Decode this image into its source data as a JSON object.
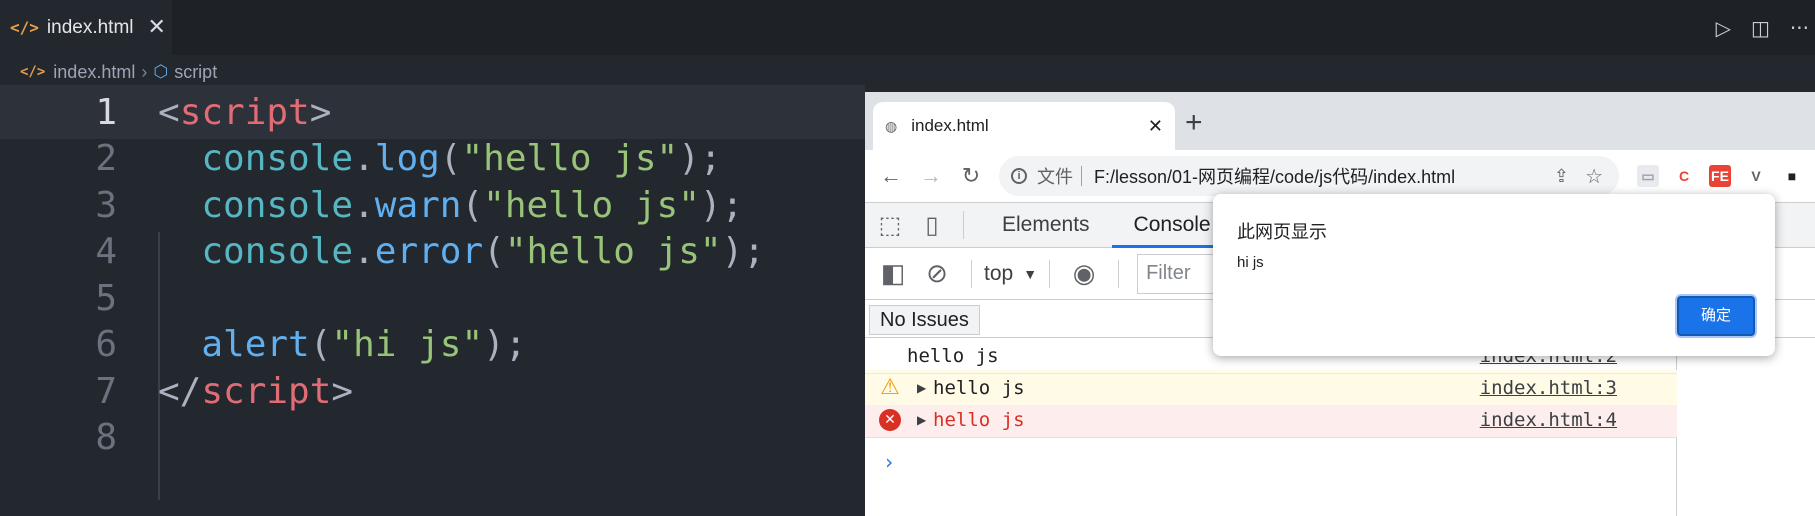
{
  "editor": {
    "tab": {
      "icon": "</>",
      "label": "index.html",
      "close": "✕"
    },
    "actions": {
      "run": "▷",
      "split": "◫",
      "more": "···"
    },
    "breadcrumb": {
      "icon": "</>",
      "file": "index.html",
      "sep": "›",
      "symbol_icon": "⬡",
      "symbol": "script"
    },
    "lines": [
      {
        "n": "1",
        "tokens": [
          [
            "t-punc",
            "<"
          ],
          [
            "t-tag",
            "script"
          ],
          [
            "t-punc",
            ">"
          ]
        ]
      },
      {
        "n": "2",
        "tokens": [
          [
            "t-punc",
            "  "
          ],
          [
            "t-obj",
            "console"
          ],
          [
            "t-punc",
            "."
          ],
          [
            "t-fn",
            "log"
          ],
          [
            "t-punc",
            "("
          ],
          [
            "t-str",
            "\"hello js\""
          ],
          [
            "t-punc",
            ");"
          ]
        ]
      },
      {
        "n": "3",
        "tokens": [
          [
            "t-punc",
            "  "
          ],
          [
            "t-obj",
            "console"
          ],
          [
            "t-punc",
            "."
          ],
          [
            "t-fn",
            "warn"
          ],
          [
            "t-punc",
            "("
          ],
          [
            "t-str",
            "\"hello js\""
          ],
          [
            "t-punc",
            ");"
          ]
        ]
      },
      {
        "n": "4",
        "tokens": [
          [
            "t-punc",
            "  "
          ],
          [
            "t-obj",
            "console"
          ],
          [
            "t-punc",
            "."
          ],
          [
            "t-fn",
            "error"
          ],
          [
            "t-punc",
            "("
          ],
          [
            "t-str",
            "\"hello js\""
          ],
          [
            "t-punc",
            ");"
          ]
        ]
      },
      {
        "n": "5",
        "tokens": []
      },
      {
        "n": "6",
        "tokens": [
          [
            "t-punc",
            "  "
          ],
          [
            "t-fn",
            "alert"
          ],
          [
            "t-punc",
            "("
          ],
          [
            "t-str",
            "\"hi js\""
          ],
          [
            "t-punc",
            ");"
          ]
        ]
      },
      {
        "n": "7",
        "tokens": [
          [
            "t-punc",
            "</"
          ],
          [
            "t-tag",
            "script"
          ],
          [
            "t-punc",
            ">"
          ]
        ]
      },
      {
        "n": "8",
        "tokens": []
      }
    ]
  },
  "browser": {
    "tab": {
      "label": "index.html",
      "close": "✕"
    },
    "new_tab": "+",
    "nav": {
      "back": "←",
      "forward": "→",
      "reload": "↻"
    },
    "omnibox": {
      "info": "i",
      "scheme": "文件",
      "url": "F:/lesson/01-网页编程/code/js代码/index.html",
      "share": "⇪",
      "star": "☆"
    },
    "extensions": [
      {
        "label": "▭",
        "color": "#9aa0a6",
        "bg": "#e8eaed"
      },
      {
        "label": "C",
        "color": "#ea4335",
        "bg": "#ffffff"
      },
      {
        "label": "FE",
        "color": "#ffffff",
        "bg": "#ea4335"
      },
      {
        "label": "V",
        "color": "#5f6368",
        "bg": "#ffffff"
      },
      {
        "label": "■",
        "color": "#202124",
        "bg": "#ffffff"
      }
    ]
  },
  "devtools": {
    "tabs": [
      "Elements",
      "Console"
    ],
    "selected_tab": "Console",
    "context": "top",
    "filter_placeholder": "Filter",
    "issues": "No Issues",
    "messages": [
      {
        "level": "log",
        "text": "hello js",
        "source": "index.html:2"
      },
      {
        "level": "warn",
        "text": "hello js",
        "source": "index.html:3"
      },
      {
        "level": "error",
        "text": "hello js",
        "source": "index.html:4"
      }
    ],
    "prompt": "›"
  },
  "alert": {
    "title": "此网页显示",
    "message": "hi js",
    "ok": "确定"
  }
}
